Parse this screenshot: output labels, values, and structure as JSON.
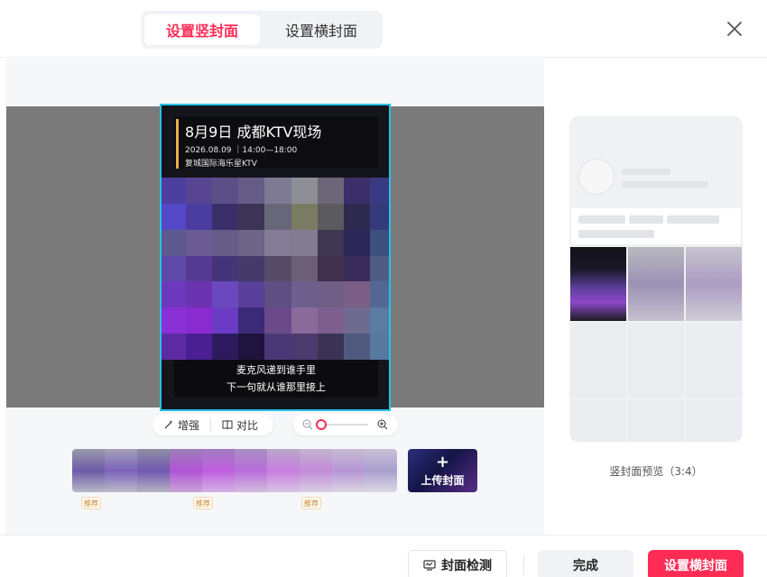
{
  "tabs": [
    {
      "label": "设置竖封面",
      "active": true
    },
    {
      "label": "设置横封面",
      "active": false
    }
  ],
  "poster": {
    "title": "8月9日 成都KTV现场",
    "time": "2026.08.09 ｜14:00—18:00",
    "venue": "复城国际海乐星KTV",
    "subtitle_line1": "麦克风递到谁手里",
    "subtitle_line2": "下一句就从谁那里接上"
  },
  "tools": {
    "enhance": "增强",
    "compare": "对比"
  },
  "zoom_level": 0.0,
  "upload": {
    "label": "上传封面",
    "plus": "+"
  },
  "tags": [
    "推荐",
    "推荐",
    "推荐"
  ],
  "preview": {
    "label": "竖封面预览（3:4）"
  },
  "footer": {
    "check_label": "封面检测",
    "done_label": "完成",
    "primary_label": "设置横封面"
  },
  "colors": {
    "accent": "#fe2c55",
    "crop_border": "#25c2e6"
  },
  "icons": {
    "close": "close-icon",
    "enhance": "magic-wand-icon",
    "compare": "compare-icon",
    "zoom_out": "zoom-out-icon",
    "zoom_in": "zoom-in-icon",
    "check": "monitor-check-icon"
  }
}
